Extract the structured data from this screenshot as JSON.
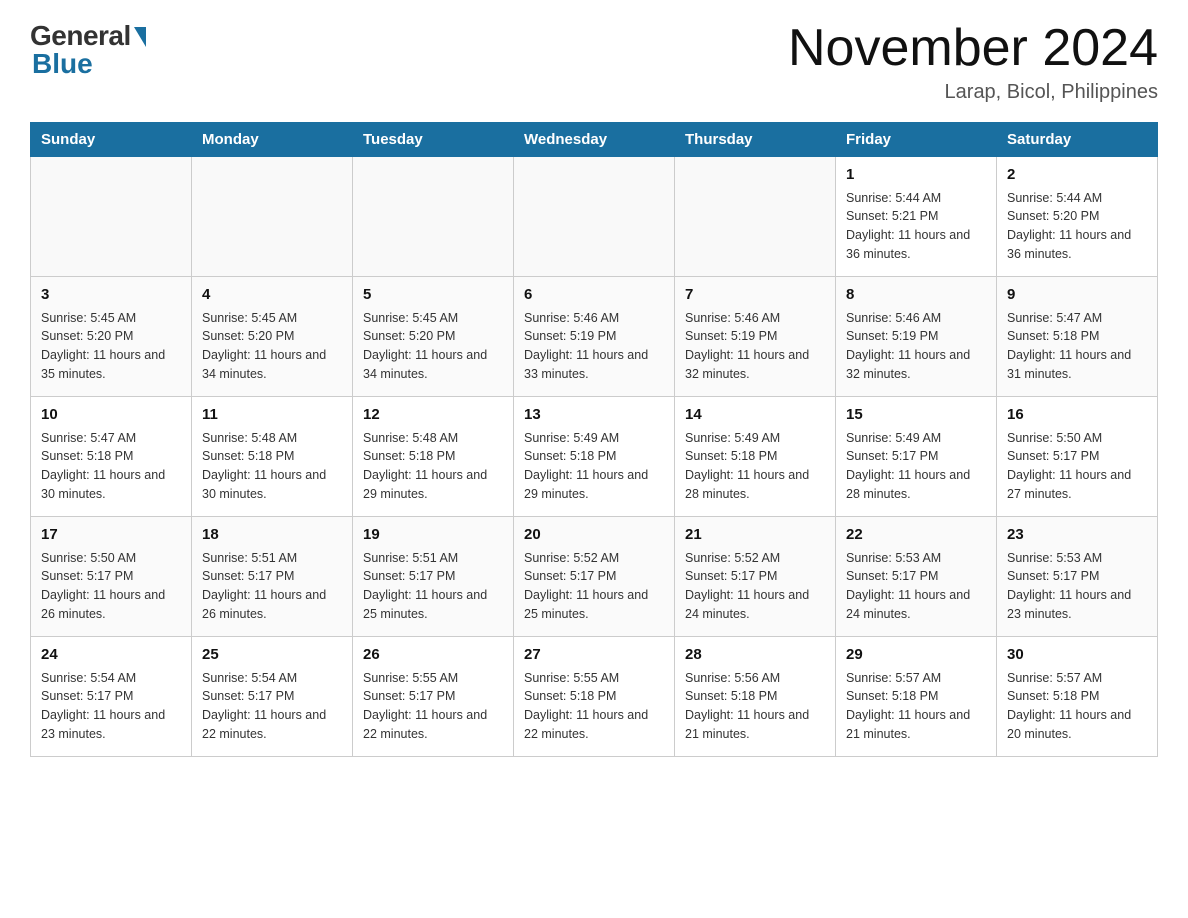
{
  "logo": {
    "general": "General",
    "blue": "Blue"
  },
  "header": {
    "month_year": "November 2024",
    "location": "Larap, Bicol, Philippines"
  },
  "days_of_week": [
    "Sunday",
    "Monday",
    "Tuesday",
    "Wednesday",
    "Thursday",
    "Friday",
    "Saturday"
  ],
  "weeks": [
    [
      {
        "day": "",
        "info": ""
      },
      {
        "day": "",
        "info": ""
      },
      {
        "day": "",
        "info": ""
      },
      {
        "day": "",
        "info": ""
      },
      {
        "day": "",
        "info": ""
      },
      {
        "day": "1",
        "info": "Sunrise: 5:44 AM\nSunset: 5:21 PM\nDaylight: 11 hours and 36 minutes."
      },
      {
        "day": "2",
        "info": "Sunrise: 5:44 AM\nSunset: 5:20 PM\nDaylight: 11 hours and 36 minutes."
      }
    ],
    [
      {
        "day": "3",
        "info": "Sunrise: 5:45 AM\nSunset: 5:20 PM\nDaylight: 11 hours and 35 minutes."
      },
      {
        "day": "4",
        "info": "Sunrise: 5:45 AM\nSunset: 5:20 PM\nDaylight: 11 hours and 34 minutes."
      },
      {
        "day": "5",
        "info": "Sunrise: 5:45 AM\nSunset: 5:20 PM\nDaylight: 11 hours and 34 minutes."
      },
      {
        "day": "6",
        "info": "Sunrise: 5:46 AM\nSunset: 5:19 PM\nDaylight: 11 hours and 33 minutes."
      },
      {
        "day": "7",
        "info": "Sunrise: 5:46 AM\nSunset: 5:19 PM\nDaylight: 11 hours and 32 minutes."
      },
      {
        "day": "8",
        "info": "Sunrise: 5:46 AM\nSunset: 5:19 PM\nDaylight: 11 hours and 32 minutes."
      },
      {
        "day": "9",
        "info": "Sunrise: 5:47 AM\nSunset: 5:18 PM\nDaylight: 11 hours and 31 minutes."
      }
    ],
    [
      {
        "day": "10",
        "info": "Sunrise: 5:47 AM\nSunset: 5:18 PM\nDaylight: 11 hours and 30 minutes."
      },
      {
        "day": "11",
        "info": "Sunrise: 5:48 AM\nSunset: 5:18 PM\nDaylight: 11 hours and 30 minutes."
      },
      {
        "day": "12",
        "info": "Sunrise: 5:48 AM\nSunset: 5:18 PM\nDaylight: 11 hours and 29 minutes."
      },
      {
        "day": "13",
        "info": "Sunrise: 5:49 AM\nSunset: 5:18 PM\nDaylight: 11 hours and 29 minutes."
      },
      {
        "day": "14",
        "info": "Sunrise: 5:49 AM\nSunset: 5:18 PM\nDaylight: 11 hours and 28 minutes."
      },
      {
        "day": "15",
        "info": "Sunrise: 5:49 AM\nSunset: 5:17 PM\nDaylight: 11 hours and 28 minutes."
      },
      {
        "day": "16",
        "info": "Sunrise: 5:50 AM\nSunset: 5:17 PM\nDaylight: 11 hours and 27 minutes."
      }
    ],
    [
      {
        "day": "17",
        "info": "Sunrise: 5:50 AM\nSunset: 5:17 PM\nDaylight: 11 hours and 26 minutes."
      },
      {
        "day": "18",
        "info": "Sunrise: 5:51 AM\nSunset: 5:17 PM\nDaylight: 11 hours and 26 minutes."
      },
      {
        "day": "19",
        "info": "Sunrise: 5:51 AM\nSunset: 5:17 PM\nDaylight: 11 hours and 25 minutes."
      },
      {
        "day": "20",
        "info": "Sunrise: 5:52 AM\nSunset: 5:17 PM\nDaylight: 11 hours and 25 minutes."
      },
      {
        "day": "21",
        "info": "Sunrise: 5:52 AM\nSunset: 5:17 PM\nDaylight: 11 hours and 24 minutes."
      },
      {
        "day": "22",
        "info": "Sunrise: 5:53 AM\nSunset: 5:17 PM\nDaylight: 11 hours and 24 minutes."
      },
      {
        "day": "23",
        "info": "Sunrise: 5:53 AM\nSunset: 5:17 PM\nDaylight: 11 hours and 23 minutes."
      }
    ],
    [
      {
        "day": "24",
        "info": "Sunrise: 5:54 AM\nSunset: 5:17 PM\nDaylight: 11 hours and 23 minutes."
      },
      {
        "day": "25",
        "info": "Sunrise: 5:54 AM\nSunset: 5:17 PM\nDaylight: 11 hours and 22 minutes."
      },
      {
        "day": "26",
        "info": "Sunrise: 5:55 AM\nSunset: 5:17 PM\nDaylight: 11 hours and 22 minutes."
      },
      {
        "day": "27",
        "info": "Sunrise: 5:55 AM\nSunset: 5:18 PM\nDaylight: 11 hours and 22 minutes."
      },
      {
        "day": "28",
        "info": "Sunrise: 5:56 AM\nSunset: 5:18 PM\nDaylight: 11 hours and 21 minutes."
      },
      {
        "day": "29",
        "info": "Sunrise: 5:57 AM\nSunset: 5:18 PM\nDaylight: 11 hours and 21 minutes."
      },
      {
        "day": "30",
        "info": "Sunrise: 5:57 AM\nSunset: 5:18 PM\nDaylight: 11 hours and 20 minutes."
      }
    ]
  ]
}
